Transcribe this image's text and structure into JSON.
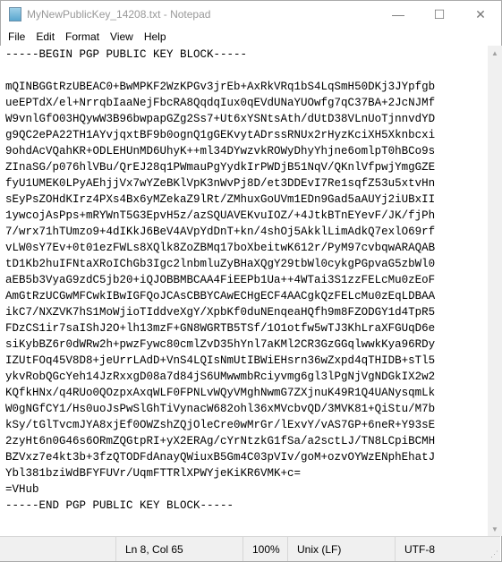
{
  "window": {
    "title": "MyNewPublicKey_14208.txt - Notepad",
    "minimize_glyph": "—",
    "maximize_glyph": "☐",
    "close_glyph": "✕"
  },
  "menu": [
    "File",
    "Edit",
    "Format",
    "View",
    "Help"
  ],
  "editor": {
    "lines": [
      "-----BEGIN PGP PUBLIC KEY BLOCK-----",
      "",
      "mQINBGGtRzUBEAC0+BwMPKF2WzKPGv3jrEb+AxRkVRq1bS4LqSmH50DKj3JYpfgb",
      "ueEPTdX/el+NrrqbIaaNejFbcRA8QqdqIux0qEVdUNaYUOwfg7qC37BA+2JcNJMf",
      "W9vnlGfO03HQywW3B96bwpapGZg2Ss7+Ut6xYSNtsAth/dUtD38VLnUoTjnnvdYD",
      "g9QC2ePA22TH1AYvjqxtBF9b0ognQ1gGEKvytADrssRNUx2rHyzKciXH5Xknbcxi",
      "9ohdAcVQahKR+ODLEHUnMD6UhyK++ml34DYwzvkROWyDhyYhjne6omlpT0hBCo9s",
      "ZInaSG/p076hlVBu/QrEJ28q1PWmauPgYydkIrPWDjB51NqV/QKnlVfpwjYmgGZE",
      "fyU1UMEK0LPyAEhjjVx7wYZeBKlVpK3nWvPj8D/et3DDEvI7Re1sqfZ53u5xtvHn",
      "sEyPsZOHdKIrz4PXs4Bx6yMZekaZ9lRt/ZMhuxGoUVm1EDn9Gad5aAUYj2iUBxII",
      "1ywcojAsPps+mRYWnT5G3EpvH5z/azSQUAVEKvuIOZ/+4JtkBTnEYevF/JK/fjPh",
      "7/wrx71hTUmzo9+4dIKkJ6BeV4AVpYdDnT+kn/4shOj5AkklLimAdkQ7exlO69rf",
      "vLW0sY7Ev+0t01ezFWLs8XQlk8ZoZBMq17boXbeitwK612r/PyM97cvbqwARAQAB",
      "tD1Kb2huIFNtaXRoIChGb3Igc2lnbmluZyBHaXQgY29tbWl0cykgPGpvaG5zbWl0",
      "aEB5b3VyaG9zdC5jb20+iQJOBBMBCAA4FiEEPb1Ua++4WTai3S1zzFELcMu0zEoF",
      "AmGtRzUCGwMFCwkIBwIGFQoJCAsCBBYCAwECHgECF4AACgkQzFELcMu0zEqLDBAA",
      "ikC7/NXZVK7hS1MoWjioTIddveXgY/XpbKf0duNEnqeaHQfh9m8FZODGY1d4TpR5",
      "FDzCS1ir7saIShJ2O+lh13mzF+GN8WGRTB5TSf/1O1otfw5wTJ3KhLraXFGUqD6e",
      "siKybBZ6r0dWRw2h+pwzFywc80cmlZvD35hYnl7aKMl2CR3GzGGqlwwkKya96RDy",
      "IZUtFOq45V8D8+jeUrrLAdD+VnS4LQIsNmUtIBWiEHsrn36wZxpd4qTHIDB+sTl5",
      "ykvRobQGcYeh14JzRxxgD08a7d84jS6UMwwmbRciyvmg6gl3lPgNjVgNDGkIX2w2",
      "KQfkHNx/q4RUo0QOzpxAxqWLF0FPNLvWQyVMghNwmG7ZXjnuK49R1Q4UANysqmLk",
      "W0gNGfCY1/Hs0uoJsPwSlGhTiVynacW682ohl36xMVcbvQD/3MVK81+QiStu/M7b",
      "kSy/tGlTvcmJYA8xjEf0OWZshZQjOleCre0wMrGr/lExvY/vAS7GP+6neR+Y93sE",
      "2zyHt6n0G46s6ORmZQGtpRI+yX2ERAg/cYrNtzkG1fSa/a2sctLJ/TN8LCpiBCMH",
      "BZVxz7e4kt3b+3fzQTODFdAnayQWiuxB5Gm4C03pVIv/goM+ozvOYWzENphEhatJ",
      "Ybl381bziWdBFYFUVr/UqmFTTRlXPWYjeKiKR6VMK+c=",
      "=VHub",
      "-----END PGP PUBLIC KEY BLOCK-----"
    ]
  },
  "statusbar": {
    "position": "Ln 8, Col 65",
    "zoom": "100%",
    "line_ending": "Unix (LF)",
    "encoding": "UTF-8"
  }
}
